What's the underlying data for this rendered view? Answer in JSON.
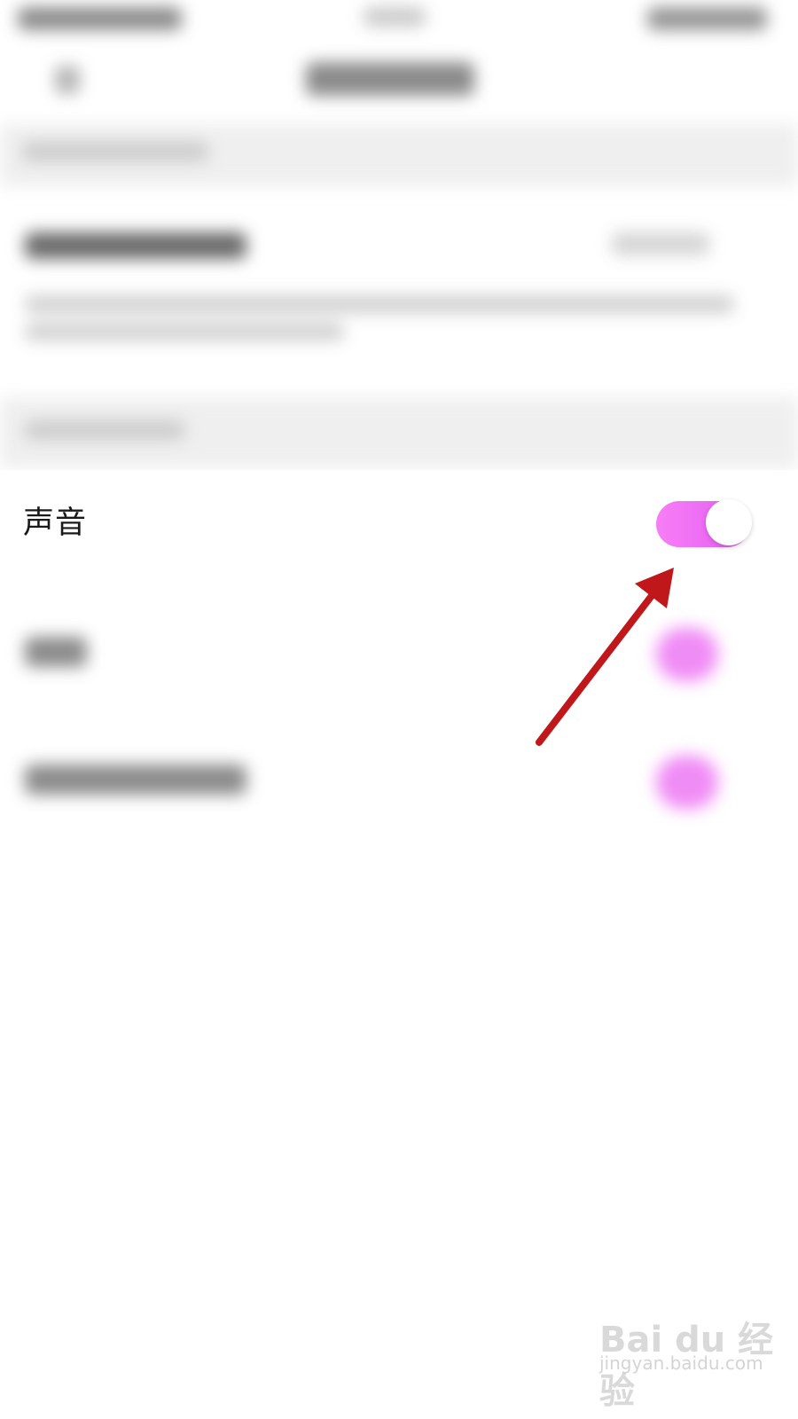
{
  "settings": {
    "sound_label": "声音",
    "sound_enabled": true
  },
  "colors": {
    "toggle_on_start": "#f77ff5",
    "toggle_on_end": "#e35af4",
    "annotation_arrow": "#c0171a"
  },
  "watermark": {
    "logo": "Bai du 经验",
    "url": "jingyan.baidu.com"
  }
}
